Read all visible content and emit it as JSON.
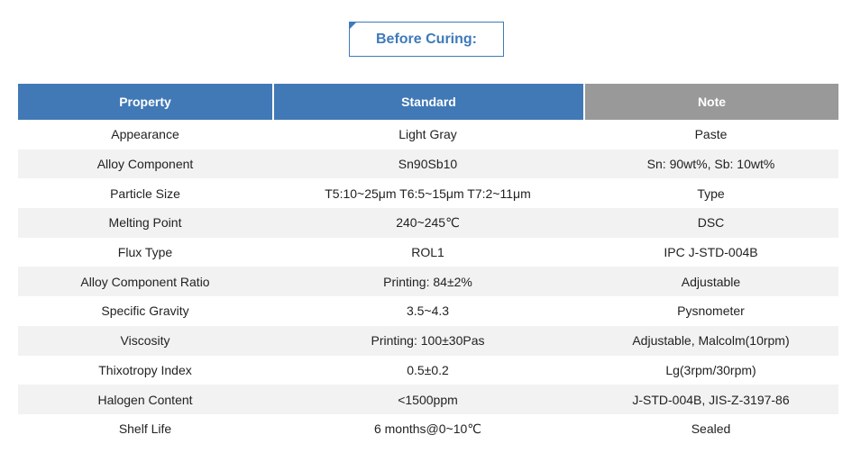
{
  "section_title": "Before Curing:",
  "colors": {
    "header_blue": "#4179b6",
    "header_gray": "#999999",
    "title_blue": "#3f7ab9",
    "row_alt": "#f2f2f2"
  },
  "table": {
    "headers": [
      "Property",
      "Standard",
      "Note"
    ],
    "rows": [
      [
        "Appearance",
        "Light Gray",
        "Paste"
      ],
      [
        "Alloy Component",
        "Sn90Sb10",
        "Sn: 90wt%, Sb: 10wt%"
      ],
      [
        "Particle Size",
        "T5:10~25μm T6:5~15μm T7:2~11μm",
        "Type"
      ],
      [
        "Melting Point",
        "240~245℃",
        "DSC"
      ],
      [
        "Flux Type",
        "ROL1",
        "IPC J-STD-004B"
      ],
      [
        "Alloy Component Ratio",
        "Printing: 84±2%",
        "Adjustable"
      ],
      [
        "Specific Gravity",
        "3.5~4.3",
        "Pysnometer"
      ],
      [
        "Viscosity",
        "Printing: 100±30Pas",
        "Adjustable, Malcolm(10rpm)"
      ],
      [
        "Thixotropy Index",
        "0.5±0.2",
        "Lg(3rpm/30rpm)"
      ],
      [
        "Halogen Content",
        "<1500ppm",
        "J-STD-004B, JIS-Z-3197-86"
      ],
      [
        "Shelf Life",
        "6 months@0~10℃",
        "Sealed"
      ]
    ]
  }
}
